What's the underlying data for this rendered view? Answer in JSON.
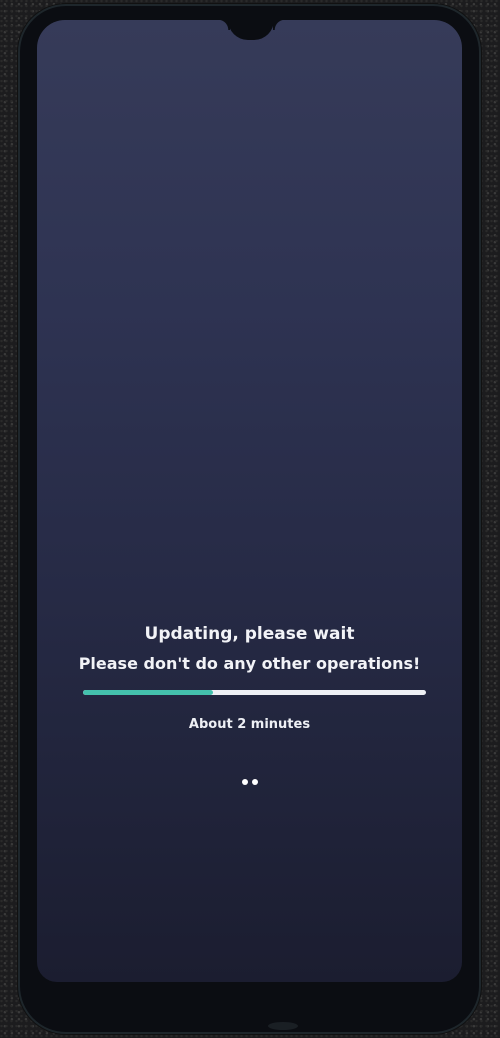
{
  "update_screen": {
    "title": "Updating, please wait",
    "subtitle": "Please don't do any other operations!",
    "progress_percent": 38,
    "time_remaining": "About  2 minutes",
    "loading_dots": 2,
    "colors": {
      "progress_fill": "#44c1ad",
      "progress_track": "#eef0f5",
      "screen_bg": "#2e3352",
      "text": "#f2f3f7"
    }
  }
}
